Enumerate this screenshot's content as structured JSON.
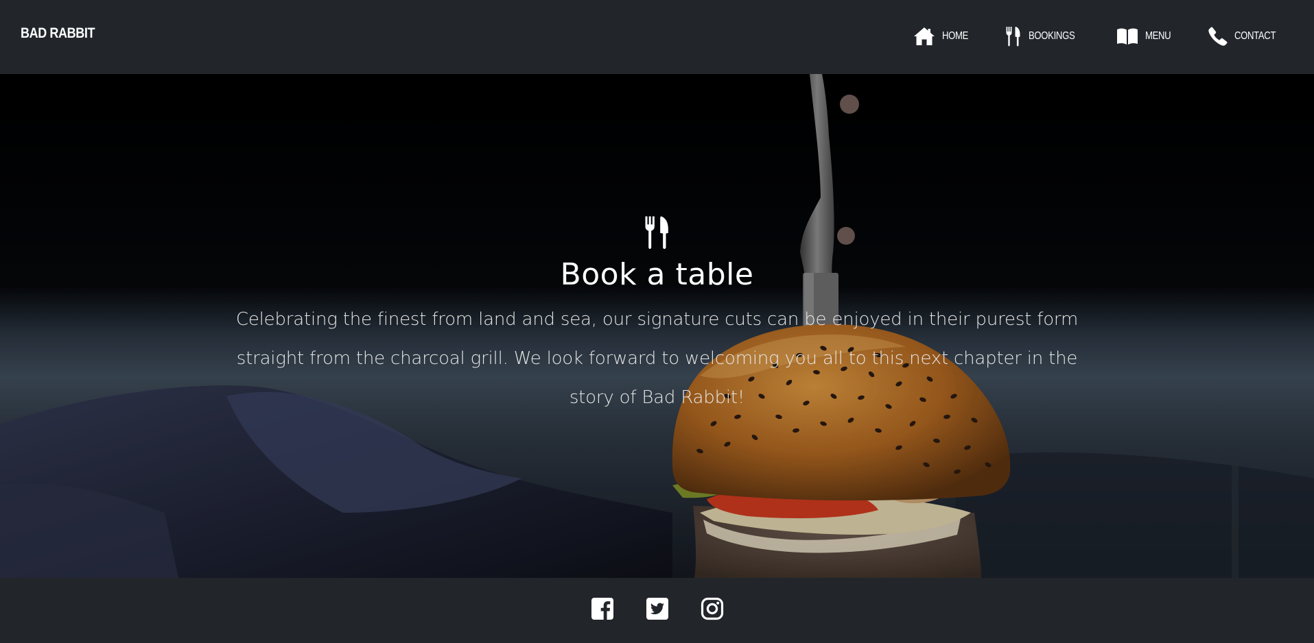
{
  "brand": "BAD RABBIT",
  "nav": {
    "items": [
      {
        "label": "HOME",
        "icon": "home-icon"
      },
      {
        "label": "BOOKINGS",
        "icon": "utensils-icon"
      },
      {
        "label": "MENU",
        "icon": "open-book-icon"
      },
      {
        "label": "CONTACT",
        "icon": "phone-icon"
      }
    ]
  },
  "hero": {
    "icon": "utensils-icon",
    "title": "Book a table",
    "text": "Celebrating the finest from land and sea, our signature cuts can be enjoyed in their purest form straight from the charcoal grill. We look forward to welcoming you all to this next chapter in the story of Bad Rabbit!",
    "image": "burger-with-knife-photo"
  },
  "footer": {
    "social": [
      "facebook-icon",
      "twitter-icon",
      "instagram-icon"
    ]
  },
  "colors": {
    "bar_background": "#22262b",
    "text": "#ffffff"
  }
}
